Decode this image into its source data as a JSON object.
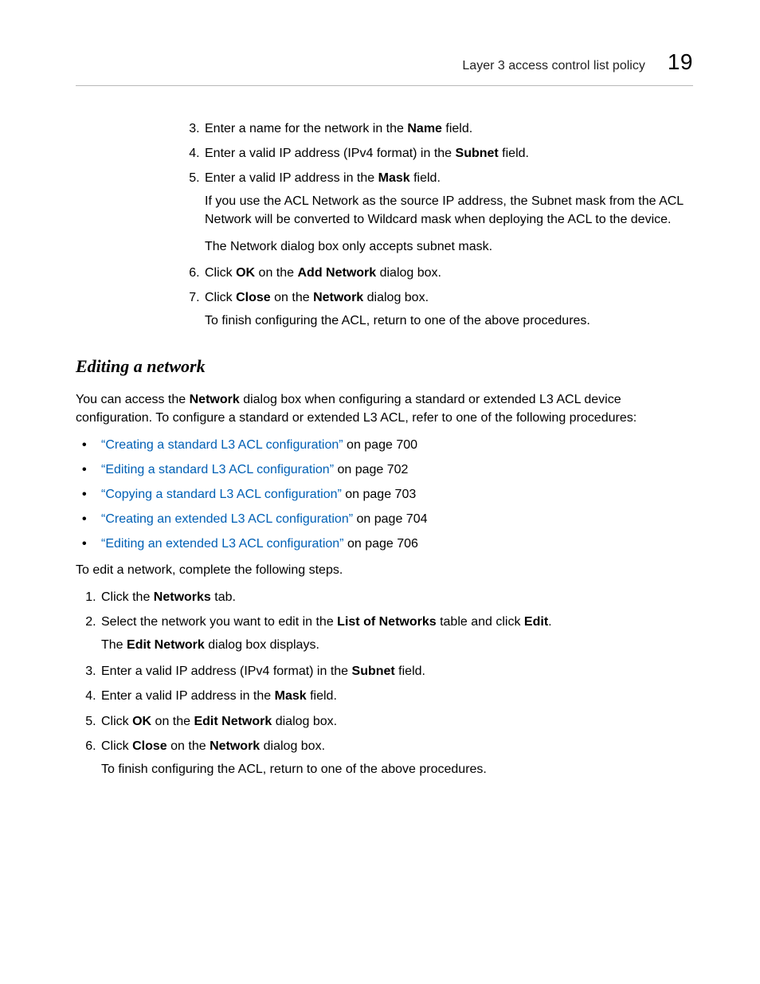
{
  "header": {
    "title": "Layer 3 access control list policy",
    "chapter_number": "19"
  },
  "section1": {
    "ol_start": 3,
    "items": [
      {
        "segments": [
          {
            "t": "Enter a name for the network in the "
          },
          {
            "t": "Name",
            "b": true
          },
          {
            "t": " field."
          }
        ]
      },
      {
        "segments": [
          {
            "t": "Enter a valid IP address (IPv4 format) in the "
          },
          {
            "t": "Subnet",
            "b": true
          },
          {
            "t": " field."
          }
        ]
      },
      {
        "segments": [
          {
            "t": "Enter a valid IP address in the "
          },
          {
            "t": "Mask",
            "b": true
          },
          {
            "t": " field."
          }
        ],
        "sub": [
          {
            "segments": [
              {
                "t": "If you use the ACL Network as the source IP address, the Subnet mask from the ACL Network will be converted to Wildcard mask when deploying the ACL to the device."
              }
            ]
          },
          {
            "segments": [
              {
                "t": "The Network dialog box only accepts subnet mask."
              }
            ]
          }
        ]
      },
      {
        "segments": [
          {
            "t": "Click "
          },
          {
            "t": "OK",
            "b": true
          },
          {
            "t": " on the "
          },
          {
            "t": "Add Network",
            "b": true
          },
          {
            "t": " dialog box."
          }
        ]
      },
      {
        "segments": [
          {
            "t": "Click "
          },
          {
            "t": "Close",
            "b": true
          },
          {
            "t": " on the "
          },
          {
            "t": "Network",
            "b": true
          },
          {
            "t": " dialog box."
          }
        ],
        "sub": [
          {
            "segments": [
              {
                "t": "To finish configuring the ACL, return to one of the above procedures."
              }
            ]
          }
        ]
      }
    ]
  },
  "section2": {
    "heading": "Editing a network",
    "intro": {
      "segments": [
        {
          "t": "You can access the "
        },
        {
          "t": "Network",
          "b": true
        },
        {
          "t": " dialog box when configuring a standard or extended L3 ACL device configuration. To configure a standard or extended L3 ACL, refer to one of the following procedures:"
        }
      ]
    },
    "links": [
      {
        "label": "“Creating a standard L3 ACL configuration”",
        "suffix": " on page 700"
      },
      {
        "label": "“Editing a standard L3 ACL configuration”",
        "suffix": " on page 702"
      },
      {
        "label": "“Copying a standard L3 ACL configuration”",
        "suffix": " on page 703"
      },
      {
        "label": "“Creating an extended L3 ACL configuration”",
        "suffix": " on page 704"
      },
      {
        "label": "“Editing an extended L3 ACL configuration”",
        "suffix": " on page 706"
      }
    ],
    "lead_in": "To edit a network, complete the following steps.",
    "steps": [
      {
        "segments": [
          {
            "t": "Click the "
          },
          {
            "t": "Networks",
            "b": true
          },
          {
            "t": " tab."
          }
        ]
      },
      {
        "segments": [
          {
            "t": "Select the network you want to edit in the "
          },
          {
            "t": "List of Networks",
            "b": true
          },
          {
            "t": " table and click "
          },
          {
            "t": "Edit",
            "b": true
          },
          {
            "t": "."
          }
        ],
        "sub": [
          {
            "segments": [
              {
                "t": "The "
              },
              {
                "t": "Edit Network",
                "b": true
              },
              {
                "t": " dialog box displays."
              }
            ]
          }
        ]
      },
      {
        "segments": [
          {
            "t": "Enter a valid IP address (IPv4 format) in the "
          },
          {
            "t": "Subnet",
            "b": true
          },
          {
            "t": " field."
          }
        ]
      },
      {
        "segments": [
          {
            "t": "Enter a valid IP address in the "
          },
          {
            "t": "Mask",
            "b": true
          },
          {
            "t": " field."
          }
        ]
      },
      {
        "segments": [
          {
            "t": "Click "
          },
          {
            "t": "OK",
            "b": true
          },
          {
            "t": " on the "
          },
          {
            "t": "Edit Network",
            "b": true
          },
          {
            "t": " dialog box."
          }
        ]
      },
      {
        "segments": [
          {
            "t": "Click "
          },
          {
            "t": "Close",
            "b": true
          },
          {
            "t": " on the "
          },
          {
            "t": "Network",
            "b": true
          },
          {
            "t": " dialog box."
          }
        ],
        "sub": [
          {
            "segments": [
              {
                "t": "To finish configuring the ACL, return to one of the above procedures."
              }
            ]
          }
        ]
      }
    ]
  }
}
